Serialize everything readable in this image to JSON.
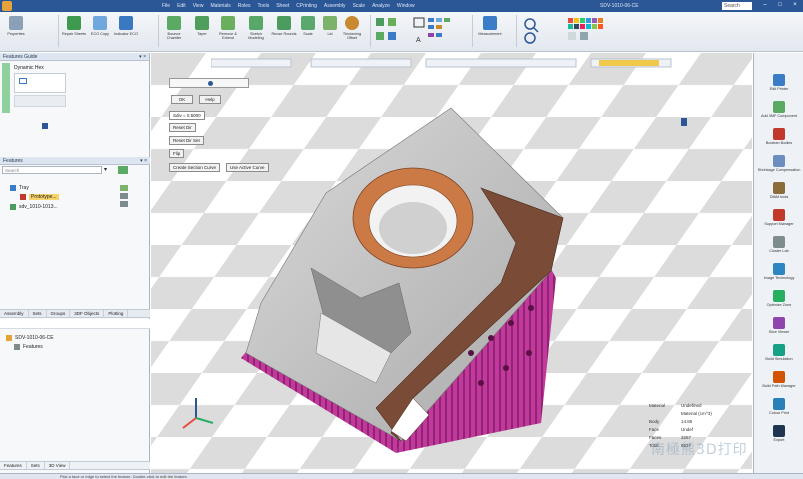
{
  "titlebar": {
    "menus": [
      "File",
      "Edit",
      "View",
      "Materials",
      "Roles",
      "Tools",
      "Sheet",
      "CPrinting",
      "Assembly",
      "Scale",
      "Analyze",
      "Window"
    ],
    "doc_title": "SDV-1010-06-CE",
    "search": "Search",
    "min": "–",
    "max": "□",
    "close": "×"
  },
  "ribbon": {
    "buttons": [
      {
        "label": "Properties",
        "icon": "properties-icon",
        "color": "#8aa0b8"
      },
      {
        "label": "Repair Sheets",
        "icon": "repair-sheets-icon",
        "color": "#3d9a4f"
      },
      {
        "label": "ECO Copy",
        "icon": "eco-copy-icon",
        "color": "#6fa8dc"
      },
      {
        "label": "Indicator ECO",
        "icon": "indicator-icon",
        "color": "#3b78c2"
      },
      {
        "label": "Bounce Chamfer",
        "icon": "bounce-chamfer-icon",
        "color": "#5aaa64"
      },
      {
        "label": "Taper",
        "icon": "taper-icon",
        "color": "#4f9e5c"
      },
      {
        "label": "Remove & Extend",
        "icon": "remove-extend-icon",
        "color": "#6aaf5b"
      },
      {
        "label": "Stretch Modeling",
        "icon": "stretch-icon",
        "color": "#58a869"
      },
      {
        "label": "Reuse Rounds",
        "icon": "reuse-rounds-icon",
        "color": "#4c9c60"
      },
      {
        "label": "Scale",
        "icon": "scale-icon",
        "color": "#5ba86e"
      },
      {
        "label": "Lid",
        "icon": "lid-icon",
        "color": "#7cb36a"
      },
      {
        "label": "Thickening Offset",
        "icon": "thicken-icon",
        "color": "#c9892e"
      },
      {
        "label": "Measurement",
        "icon": "measurement-icon",
        "color": "#3a7cc8"
      }
    ]
  },
  "left_panel": {
    "features_guide_title": "Features Guide",
    "dynamic_title": "Dynamic Hex",
    "features_title": "Features",
    "search_placeholder": "Search",
    "tree": [
      {
        "label": "Tray",
        "indent": 0
      },
      {
        "label": "Prototype...",
        "indent": 1
      },
      {
        "label": "sdv_1010-1013...",
        "indent": 0
      }
    ],
    "tabs": [
      "Assembly",
      "Sets",
      "Groups",
      "3DF Objects",
      "Plotting"
    ],
    "assembly_items": [
      "SDV-1010-06-CE",
      "Features"
    ],
    "bottom_tabs": [
      "Features",
      "Sets",
      "3D View"
    ]
  },
  "viewport": {
    "slider_value": "Sdiv = 0.5000",
    "buttons": {
      "ok": "OK",
      "cancel": "Help",
      "reset_dir": "Reset Dir",
      "reset_to_dir": "Reset Dir Set",
      "flip": "Flip",
      "create_section": "Create Section Curve",
      "use_active": "Use Active Curve"
    },
    "info": [
      {
        "k": "Material",
        "v": "Undefined"
      },
      {
        "k": "",
        "v": "Material (cm^3)"
      },
      {
        "k": "Body",
        "v": "14.85"
      },
      {
        "k": "Face",
        "v": "Undef"
      },
      {
        "k": "Faces",
        "v": "3257"
      },
      {
        "k": "Total",
        "v": "6537"
      }
    ],
    "watermark": "南極熊3D打印"
  },
  "right_panel": {
    "items": [
      {
        "label": "Edit Printer",
        "color": "#3a7cc8"
      },
      {
        "label": "Add 3MF Component",
        "color": "#5aaa64"
      },
      {
        "label": "Boolean Bodies",
        "color": "#c0392b"
      },
      {
        "label": "Shrinkage Compensation",
        "color": "#6c8ebf"
      },
      {
        "label": "DfAM tools",
        "color": "#8a6d3b"
      },
      {
        "label": "Support Manager",
        "color": "#c0392b"
      },
      {
        "label": "Cluster Lab",
        "color": "#7f8c8d"
      },
      {
        "label": "Image Technology",
        "color": "#2e86c1"
      },
      {
        "label": "Optimize Zone",
        "color": "#27ae60"
      },
      {
        "label": "Slice Viewer",
        "color": "#8e44ad"
      },
      {
        "label": "Build Simulation",
        "color": "#16a085"
      },
      {
        "label": "Build Path Manager",
        "color": "#d35400"
      },
      {
        "label": "Colour Print",
        "color": "#2980b9"
      },
      {
        "label": "Export",
        "color": "#1f3550"
      }
    ]
  },
  "statusbar": "Pick a face or edge to select the feature. Double-click to edit the feature."
}
